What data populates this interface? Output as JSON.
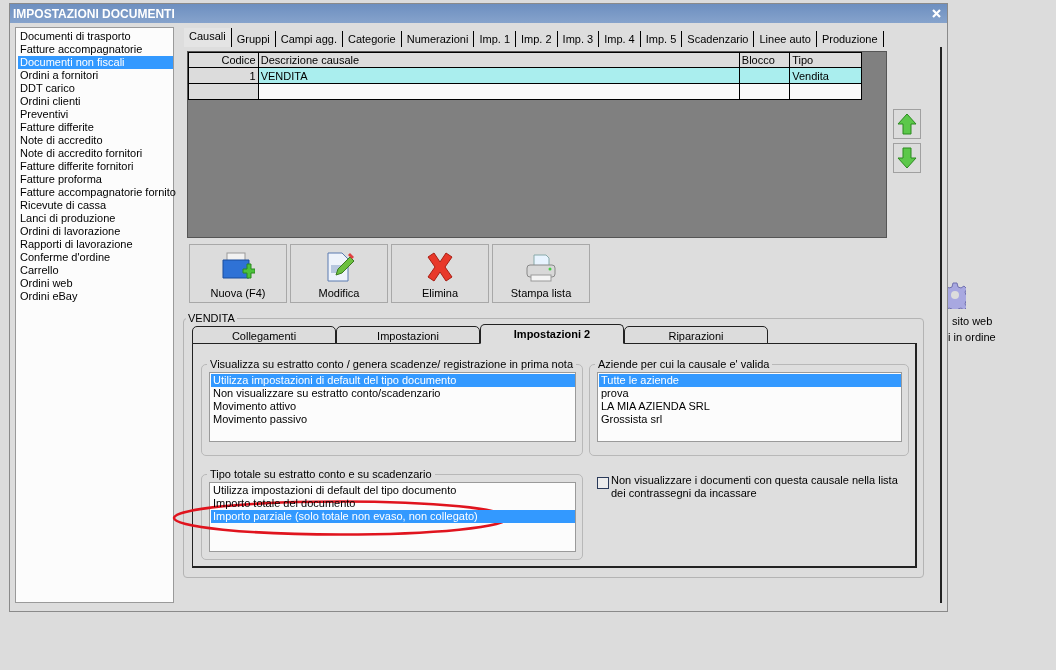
{
  "window": {
    "title": "IMPOSTAZIONI DOCUMENTI"
  },
  "sidebar": {
    "items": [
      {
        "label": "Documenti di trasporto",
        "selected": false
      },
      {
        "label": "Fatture accompagnatorie",
        "selected": false
      },
      {
        "label": "Documenti non fiscali",
        "selected": true
      },
      {
        "label": "Ordini a fornitori",
        "selected": false
      },
      {
        "label": "DDT carico",
        "selected": false
      },
      {
        "label": "Ordini clienti",
        "selected": false
      },
      {
        "label": "Preventivi",
        "selected": false
      },
      {
        "label": "Fatture differite",
        "selected": false
      },
      {
        "label": "Note di accredito",
        "selected": false
      },
      {
        "label": "Note di accredito fornitori",
        "selected": false
      },
      {
        "label": "Fatture differite fornitori",
        "selected": false
      },
      {
        "label": "Fatture proforma",
        "selected": false
      },
      {
        "label": "Fatture accompagnatorie fornito",
        "selected": false
      },
      {
        "label": "Ricevute di cassa",
        "selected": false
      },
      {
        "label": "Lanci di produzione",
        "selected": false
      },
      {
        "label": "Ordini di lavorazione",
        "selected": false
      },
      {
        "label": "Rapporti di lavorazione",
        "selected": false
      },
      {
        "label": "Conferme d'ordine",
        "selected": false
      },
      {
        "label": "Carrello",
        "selected": false
      },
      {
        "label": "Ordini web",
        "selected": false
      },
      {
        "label": "Ordini eBay",
        "selected": false
      }
    ]
  },
  "tabs": [
    {
      "label": "Causali",
      "selected": true
    },
    {
      "label": "Gruppi",
      "selected": false
    },
    {
      "label": "Campi agg.",
      "selected": false
    },
    {
      "label": "Categorie",
      "selected": false
    },
    {
      "label": "Numerazioni",
      "selected": false
    },
    {
      "label": "Imp. 1",
      "selected": false
    },
    {
      "label": "Imp. 2",
      "selected": false
    },
    {
      "label": "Imp. 3",
      "selected": false
    },
    {
      "label": "Imp. 4",
      "selected": false
    },
    {
      "label": "Imp. 5",
      "selected": false
    },
    {
      "label": "Scadenzario",
      "selected": false
    },
    {
      "label": "Linee auto",
      "selected": false
    },
    {
      "label": "Produzione",
      "selected": false
    }
  ],
  "table": {
    "columns": [
      {
        "label": "Codice"
      },
      {
        "label": "Descrizione causale"
      },
      {
        "label": "Blocco"
      },
      {
        "label": "Tipo"
      }
    ],
    "rows": [
      {
        "codice": "1",
        "descrizione": "VENDITA",
        "tipo": "Vendita",
        "selected": true
      }
    ]
  },
  "actions": [
    {
      "label": "Nuova (F4)",
      "kind": "new"
    },
    {
      "label": "Modifica",
      "kind": "edit"
    },
    {
      "label": "Elimina",
      "kind": "delete"
    },
    {
      "label": "Stampa lista",
      "kind": "print"
    }
  ],
  "causale": {
    "title": "VENDITA",
    "tabs": [
      {
        "label": "Collegamenti",
        "selected": false
      },
      {
        "label": "Impostazioni",
        "selected": false
      },
      {
        "label": "Impostazioni 2",
        "selected": true
      },
      {
        "label": "Riparazioni",
        "selected": false
      }
    ],
    "visualizza": {
      "title": "Visualizza su estratto conto / genera scadenze/ registrazione  in prima nota",
      "items": [
        {
          "label": "Utilizza impostazioni di default del tipo documento",
          "selected": true
        },
        {
          "label": "Non visualizzare su estratto conto/scadenzario",
          "selected": false
        },
        {
          "label": "Movimento attivo",
          "selected": false
        },
        {
          "label": "Movimento passivo",
          "selected": false
        }
      ]
    },
    "aziende": {
      "title": "Aziende per cui la causale e' valida",
      "items": [
        {
          "label": "Tutte le aziende",
          "selected": true
        },
        {
          "label": "prova",
          "selected": false
        },
        {
          "label": "LA MIA AZIENDA SRL",
          "selected": false
        },
        {
          "label": "Grossista srl",
          "selected": false
        }
      ]
    },
    "tipo_totale": {
      "title": "Tipo totale su estratto conto e su scadenzario",
      "items": [
        {
          "label": "Utilizza impostazioni di default del tipo documento",
          "selected": false,
          "circled": false
        },
        {
          "label": "Importo totale del documento",
          "selected": false,
          "circled": false
        },
        {
          "label": "Importo parziale (solo totale non evaso, non collegato)",
          "selected": true,
          "circled": true
        }
      ]
    },
    "checkbox": {
      "label": "Non visualizzare i documenti con questa causale nella lista dei contrassegni da incassare",
      "checked": false
    }
  },
  "desktop": {
    "labels": [
      "sito web",
      "i in ordine"
    ]
  }
}
